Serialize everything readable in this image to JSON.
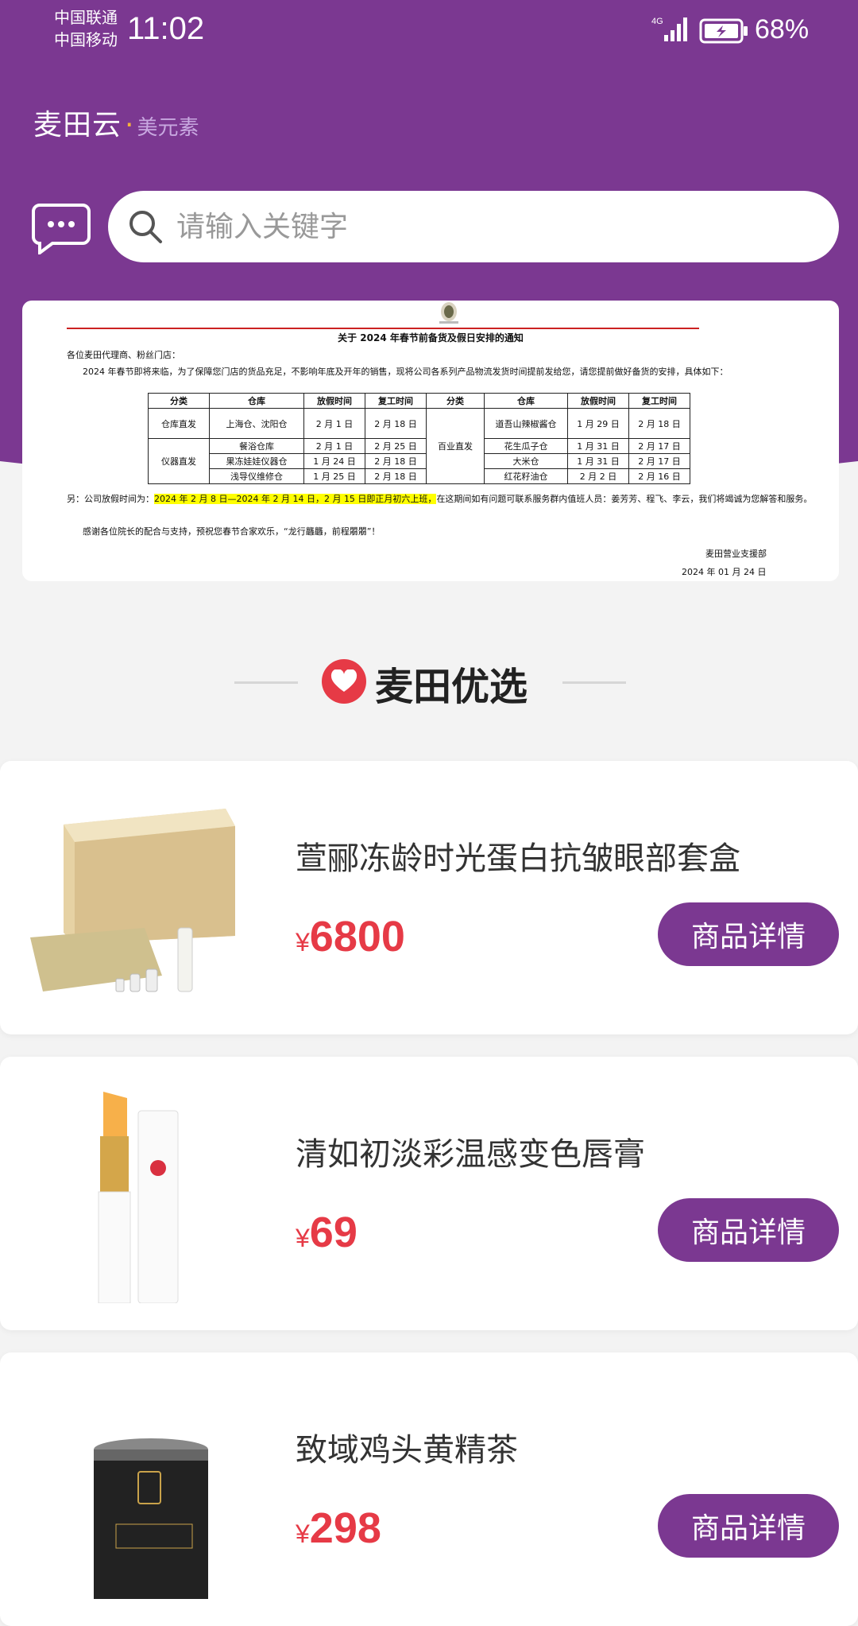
{
  "colors": {
    "brand": "#7b3891",
    "price": "#e63a46",
    "background": "#f3f3f3"
  },
  "status": {
    "carrier1": "中国联通",
    "carrier2": "中国移动",
    "time": "11:02",
    "network": "4G",
    "battery": "68%"
  },
  "brand": {
    "main": "麦田云",
    "sub": "美元素"
  },
  "search": {
    "placeholder": "请输入关键字",
    "icon": "search-icon",
    "chat_icon": "chat-icon"
  },
  "notice": {
    "title": "关于 2024 年春节前备货及假日安排的通知",
    "greeting": "各位麦田代理商、粉丝门店：",
    "paragraph": "2024 年春节即将来临，为了保障您门店的货品充足，不影响年底及开年的销售，现将公司各系列产品物流发货时间提前发给您，请您提前做好备货的安排，具体如下：",
    "table_headers": [
      "分类",
      "仓库",
      "放假时间",
      "复工时间",
      "分类",
      "仓库",
      "放假时间",
      "复工时间"
    ],
    "left_groups": [
      {
        "category": "仓库直发",
        "rows": [
          [
            "上海仓、沈阳仓",
            "2 月 1 日",
            "2 月 18 日"
          ]
        ]
      },
      {
        "category": "仪器直发",
        "rows": [
          [
            "餐浴仓库",
            "2 月 1 日",
            "2 月 25 日"
          ],
          [
            "果冻娃娃仪器仓",
            "1 月 24 日",
            "2 月 18 日"
          ],
          [
            "浅导仪维修仓",
            "1 月 25 日",
            "2 月 18 日"
          ]
        ]
      }
    ],
    "right_category": "百业直发",
    "right_rows": [
      [
        "道吾山辣椒酱仓",
        "1 月 29 日",
        "2 月 18 日"
      ],
      [
        "花生瓜子仓",
        "1 月 31 日",
        "2 月 17 日"
      ],
      [
        "大米仓",
        "1 月 31 日",
        "2 月 17 日"
      ],
      [
        "红花籽油仓",
        "2 月 2 日",
        "2 月 16 日"
      ]
    ],
    "extra_prefix": "另：公司放假时间为：",
    "extra_highlight": "2024 年 2 月 8 日—2024 年 2 月 14 日，2 月 15 日即正月初六上班，",
    "extra_suffix": "在这期间如有问题可联系服务群内值班人员：姜芳芳、程飞、李云，我们将竭诚为您解答和服务。",
    "thanks": "感谢各位院长的配合与支持，预祝您春节合家欢乐，“龙行龘龘，前程朤朤”！",
    "department": "麦田营业支援部",
    "date": "2024 年 01 月 24 日"
  },
  "section": {
    "title": "麦田优选",
    "icon": "heart-icon"
  },
  "products": [
    {
      "name": "萱郦冻龄时光蛋白抗皱眼部套盒",
      "currency": "¥",
      "price": "6800",
      "button": "商品详情"
    },
    {
      "name": "清如初淡彩温感变色唇膏",
      "currency": "¥",
      "price": "69",
      "button": "商品详情"
    },
    {
      "name": "致域鸡头黄精茶",
      "currency": "¥",
      "price": "298",
      "button": "商品详情"
    }
  ]
}
